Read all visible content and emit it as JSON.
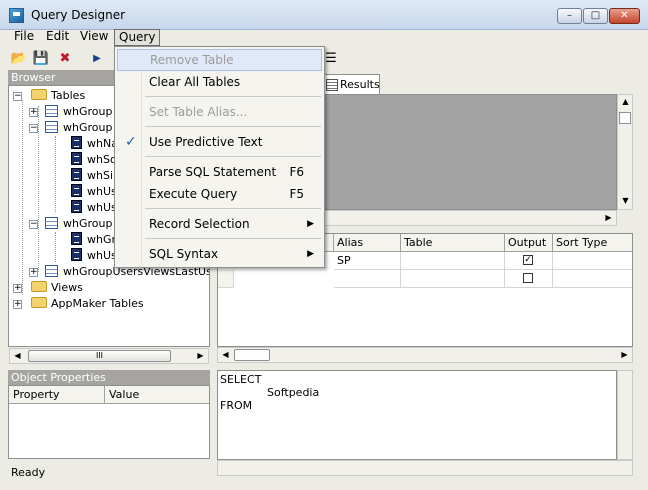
{
  "window": {
    "title": "Query Designer",
    "minimize": "–",
    "maximize": "□",
    "close": "✕"
  },
  "menubar": {
    "file": "File",
    "edit": "Edit",
    "view": "View",
    "query": "Query"
  },
  "toolbar": {
    "open": "📂",
    "save": "💾",
    "delete": "✖",
    "run": "▶",
    "extra": "☰"
  },
  "browser": {
    "title": "Browser",
    "tables": "Tables",
    "nodes": [
      "whGroup",
      "whGroup",
      "whNa",
      "whSo",
      "whSi",
      "whUs",
      "whUs",
      "whGroup",
      "whGr",
      "whUs",
      "whGroupUsersViewsLastUse"
    ],
    "views": "Views",
    "appmaker": "AppMaker Tables",
    "scroll_grip": "III"
  },
  "object_properties": {
    "title": "Object Properties",
    "col_property": "Property",
    "col_value": "Value"
  },
  "status": "Ready",
  "tabs": {
    "results": "Results"
  },
  "grid": {
    "columns": [
      "Alias",
      "Table",
      "Output",
      "Sort Type"
    ],
    "rows": [
      {
        "alias": "SP",
        "table": "",
        "output": "✓"
      },
      {
        "alias": "",
        "table": "",
        "output": ""
      }
    ]
  },
  "sql": {
    "line1": "SELECT",
    "line2": "Softpedia",
    "line3": "FROM"
  },
  "query_menu": {
    "remove_table": "Remove Table",
    "clear_all_tables": "Clear All Tables",
    "set_table_alias": "Set Table Alias...",
    "check": "✓",
    "use_predictive_text": "Use Predictive Text",
    "parse_sql": "Parse SQL Statement",
    "parse_sql_shortcut": "F6",
    "execute_query": "Execute Query",
    "execute_query_shortcut": "F5",
    "record_selection": "Record Selection",
    "sql_syntax": "SQL Syntax",
    "submenu_arrow": "▶"
  }
}
